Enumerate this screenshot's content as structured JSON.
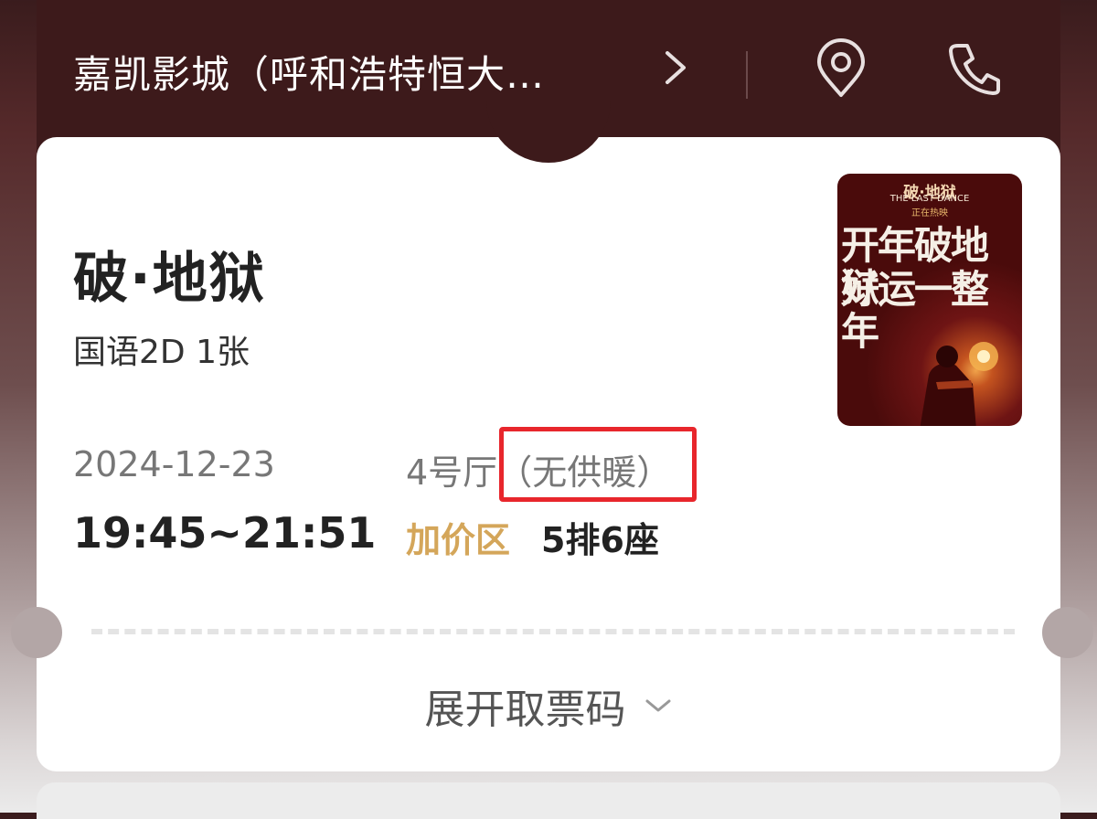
{
  "header": {
    "cinema_name": "嘉凯影城（呼和浩特恒大…",
    "icons": [
      "chevron-right-icon",
      "location-pin-icon",
      "phone-icon"
    ]
  },
  "ticket": {
    "movie_title": "破·地狱",
    "format": "国语2D 1张",
    "date": "2024-12-23",
    "time": "19:45~21:51",
    "hall": "4号厅",
    "hall_note": "（无供暖）",
    "zone": "加价区",
    "seat": "5排6座"
  },
  "poster": {
    "title": "破·地狱",
    "subtitle_en": "THE LAST DANCE",
    "status": "正在热映",
    "slogan_line1": "开年破地狱",
    "slogan_line2": "好运一整年"
  },
  "expand": {
    "label": "展开取票码"
  },
  "colors": {
    "header_bg": "#3d1a1b",
    "zone_gold": "#d4a65a",
    "highlight_red": "#e8262c"
  }
}
